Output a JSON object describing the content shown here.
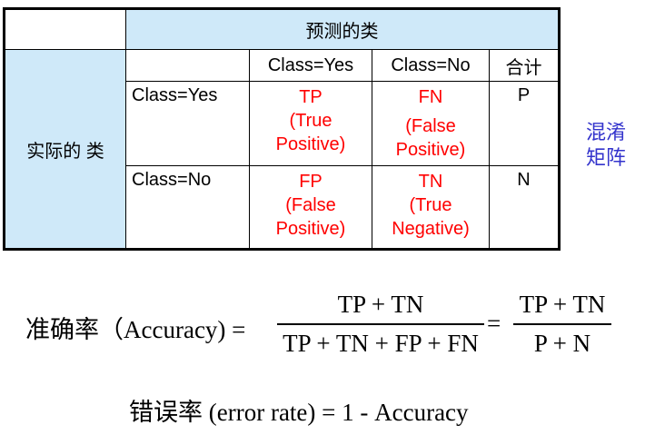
{
  "table": {
    "predicted_header": "预测的类",
    "actual_header": "实际的 类",
    "col_headers": [
      "Class=Yes",
      "Class=No",
      "合计"
    ],
    "rows": [
      {
        "label": "Class=Yes",
        "cells": [
          [
            "TP",
            "(True",
            "Positive)"
          ],
          [
            "FN",
            "(False",
            "Positive)"
          ]
        ],
        "total": "P"
      },
      {
        "label": "Class=No",
        "cells": [
          [
            "FP",
            "(False",
            "Positive)"
          ],
          [
            "TN",
            "(True",
            "Negative)"
          ]
        ],
        "total": "N"
      }
    ],
    "colors": {
      "header_bg": "#cfe9f9",
      "cell_text": "#ff0000"
    }
  },
  "side_label": [
    "混淆",
    "矩阵"
  ],
  "accuracy_formula": {
    "label": "准确率（Accuracy) =",
    "numerator": "TP + TN",
    "denominator": "TP + TN + FP + FN",
    "equals": "=",
    "numerator2": "TP + TN",
    "denominator2": "P + N"
  },
  "error_formula": "错误率 (error rate) = 1 - Accuracy",
  "colors": {
    "side_label": "#3333cc"
  }
}
